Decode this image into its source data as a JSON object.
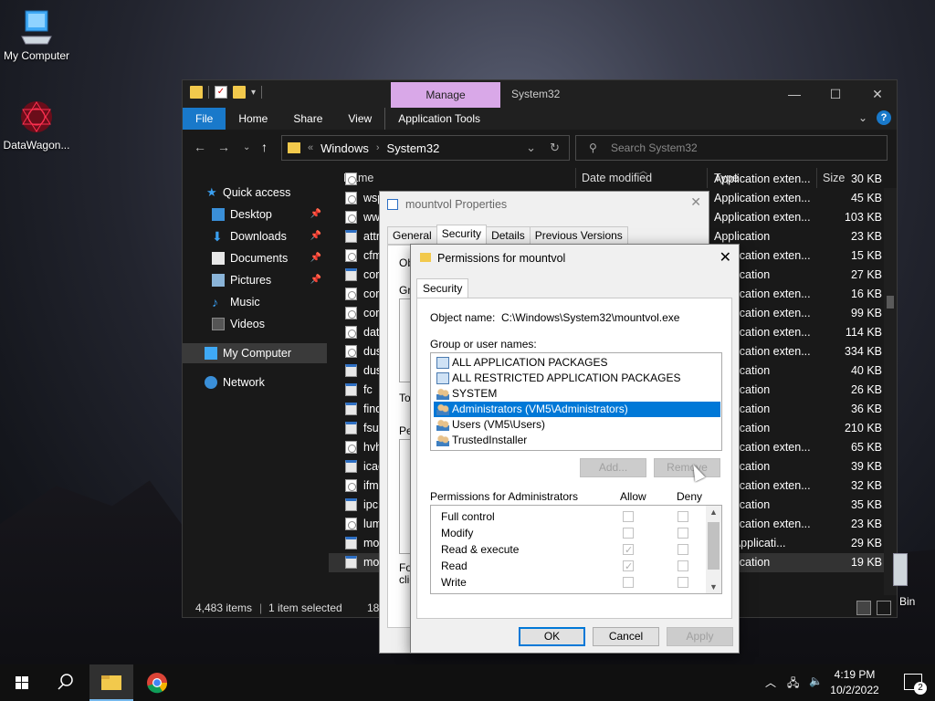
{
  "desktop": {
    "icons": [
      {
        "label": "My Computer",
        "icon": "computer-icon"
      },
      {
        "label": "DataWagon...",
        "icon": "datawagon-icon"
      }
    ],
    "recycle_bin_partial_label": "Bin"
  },
  "explorer": {
    "title": "System32",
    "manage_tab": "Manage",
    "ribbon_tabs": [
      "File",
      "Home",
      "Share",
      "View",
      "Application Tools"
    ],
    "address": {
      "parts": [
        "Windows",
        "System32"
      ],
      "separator": "›",
      "chevron": "«"
    },
    "search_placeholder": "Search System32",
    "columns": {
      "name": "Name",
      "date": "Date modified",
      "type": "Type",
      "size": "Size"
    },
    "nav": [
      {
        "label": "Quick access",
        "icon": "star-icon",
        "pinned": false
      },
      {
        "label": "Desktop",
        "icon": "desktop-icon",
        "pinned": true
      },
      {
        "label": "Downloads",
        "icon": "downloads-icon",
        "pinned": true
      },
      {
        "label": "Documents",
        "icon": "documents-icon",
        "pinned": true
      },
      {
        "label": "Pictures",
        "icon": "pictures-icon",
        "pinned": true
      },
      {
        "label": "Music",
        "icon": "music-icon",
        "pinned": false
      },
      {
        "label": "Videos",
        "icon": "videos-icon",
        "pinned": false
      },
      {
        "label": "My Computer",
        "icon": "computer-icon",
        "pinned": false
      },
      {
        "label": "Network",
        "icon": "network-icon",
        "pinned": false
      }
    ],
    "rows": [
      {
        "name": "",
        "type": "Application exten...",
        "size": "30 KB",
        "icon": "dll"
      },
      {
        "name": "wsp",
        "type": "Application exten...",
        "size": "45 KB",
        "icon": "dll"
      },
      {
        "name": "ww",
        "type": "Application exten...",
        "size": "103 KB",
        "icon": "dll"
      },
      {
        "name": "attr",
        "type": "Application",
        "size": "23 KB",
        "icon": "exe"
      },
      {
        "name": "cfm",
        "type": "Application exten...",
        "size": "15 KB",
        "icon": "dll"
      },
      {
        "name": "cor",
        "type": "Application",
        "size": "27 KB",
        "icon": "exe"
      },
      {
        "name": "cor",
        "type": "Application exten...",
        "size": "16 KB",
        "icon": "dll"
      },
      {
        "name": "cor",
        "type": "Application exten...",
        "size": "99 KB",
        "icon": "dll"
      },
      {
        "name": "dat",
        "type": "Application exten...",
        "size": "114 KB",
        "icon": "dll"
      },
      {
        "name": "dus",
        "type": "Application exten...",
        "size": "334 KB",
        "icon": "dll"
      },
      {
        "name": "dus",
        "type": "Application",
        "size": "40 KB",
        "icon": "exe"
      },
      {
        "name": "fc",
        "type": "Application",
        "size": "26 KB",
        "icon": "exe"
      },
      {
        "name": "find",
        "type": "Application",
        "size": "36 KB",
        "icon": "exe"
      },
      {
        "name": "fsut",
        "type": "Application",
        "size": "210 KB",
        "icon": "exe"
      },
      {
        "name": "hvh",
        "type": "Application exten...",
        "size": "65 KB",
        "icon": "dll"
      },
      {
        "name": "icac",
        "type": "Application",
        "size": "39 KB",
        "icon": "exe"
      },
      {
        "name": "ifm",
        "type": "Application exten...",
        "size": "32 KB",
        "icon": "dll"
      },
      {
        "name": "ipc",
        "type": "Application",
        "size": "35 KB",
        "icon": "exe"
      },
      {
        "name": "lum",
        "type": "Application exten...",
        "size": "23 KB",
        "icon": "dll"
      },
      {
        "name": "mo",
        "type": "OS Applicati...",
        "size": "29 KB",
        "icon": "exe"
      },
      {
        "name": "mo",
        "type": "Application",
        "size": "19 KB",
        "icon": "exe",
        "selected": true
      }
    ],
    "status": {
      "items": "4,483 items",
      "selected": "1 item selected",
      "size": "18.5 K"
    }
  },
  "properties": {
    "title": "mountvol Properties",
    "tabs": [
      "General",
      "Security",
      "Details",
      "Previous Versions"
    ],
    "active_tab": "Security",
    "stubs": [
      "Ob",
      "Gr",
      "To",
      "Pe",
      "Fo",
      "clic"
    ]
  },
  "permissions": {
    "title": "Permissions for mountvol",
    "tab": "Security",
    "object_label": "Object name:",
    "object_value": "C:\\Windows\\System32\\mountvol.exe",
    "group_label": "Group or user names:",
    "groups": [
      {
        "name": "ALL APPLICATION PACKAGES",
        "icon": "package-group-icon"
      },
      {
        "name": "ALL RESTRICTED APPLICATION PACKAGES",
        "icon": "package-group-icon"
      },
      {
        "name": "SYSTEM",
        "icon": "users-icon"
      },
      {
        "name": "Administrators (VM5\\Administrators)",
        "icon": "users-icon",
        "selected": true
      },
      {
        "name": "Users (VM5\\Users)",
        "icon": "users-icon"
      },
      {
        "name": "TrustedInstaller",
        "icon": "users-icon"
      }
    ],
    "add_button": "Add...",
    "remove_button": "Remove",
    "perm_header": "Permissions for Administrators",
    "allow_header": "Allow",
    "deny_header": "Deny",
    "permissions": [
      {
        "name": "Full control",
        "allow": false,
        "deny": false
      },
      {
        "name": "Modify",
        "allow": false,
        "deny": false
      },
      {
        "name": "Read & execute",
        "allow": true,
        "deny": false
      },
      {
        "name": "Read",
        "allow": true,
        "deny": false
      },
      {
        "name": "Write",
        "allow": false,
        "deny": false
      }
    ],
    "ok": "OK",
    "cancel": "Cancel",
    "apply": "Apply"
  },
  "taskbar": {
    "time": "4:19 PM",
    "date": "10/2/2022",
    "notification_count": "2"
  }
}
